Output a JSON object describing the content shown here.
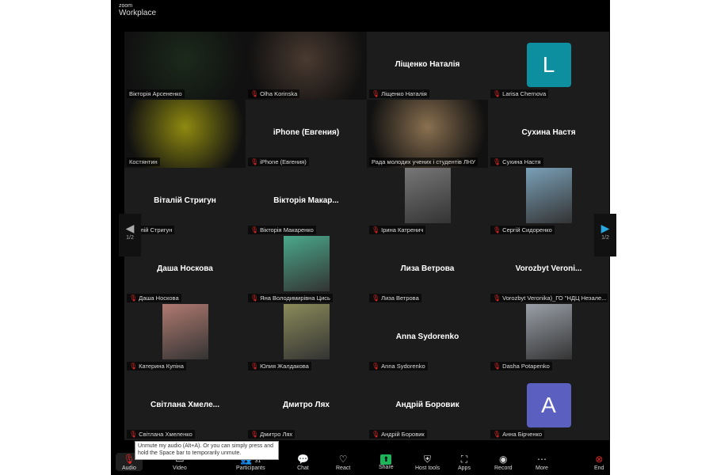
{
  "app": {
    "brand_small": "zoom",
    "brand": "Workplace"
  },
  "pager": {
    "left": "1/2",
    "right": "1/2"
  },
  "tiles": [
    {
      "name": "Вікторія Арсененко",
      "type": "video",
      "color": "#1b2a1b",
      "active": true,
      "muted": false
    },
    {
      "name": "Olha Korinska",
      "type": "video",
      "color": "#4a3a30",
      "muted": true
    },
    {
      "name": "Ліщенко Наталія",
      "center": "Ліщенко Наталія",
      "type": "name",
      "muted": true
    },
    {
      "name": "Larisa Chernova",
      "type": "avatar",
      "letter": "L",
      "color": "#0e8fa0",
      "muted": true
    },
    {
      "name": "Костянтин",
      "type": "video",
      "color": "#8f8a10",
      "muted": false
    },
    {
      "name": "iPhone (Евгения)",
      "center": "iPhone (Евгения)",
      "type": "name",
      "muted": true
    },
    {
      "name": "Рада молодих учених і студентів ЛНУ",
      "type": "video",
      "color": "#8a7050",
      "muted": false
    },
    {
      "name": "Сухина Настя",
      "center": "Сухина Настя",
      "type": "name",
      "muted": true
    },
    {
      "name": "Віталій Стригун",
      "center": "Віталій Стригун",
      "type": "name",
      "muted": false
    },
    {
      "name": "Вікторія Макаренко",
      "center": "Вікторія Макар...",
      "type": "name",
      "muted": true
    },
    {
      "name": "Ірина Катренич",
      "type": "photo",
      "color": "#777",
      "muted": true
    },
    {
      "name": "Сергій Сидоренко",
      "type": "photo",
      "color": "#7aa0b8",
      "muted": true
    },
    {
      "name": "Даша Носкова",
      "center": "Даша Носкова",
      "type": "name",
      "muted": true
    },
    {
      "name": "Яна Володимирівна Цись",
      "type": "photo",
      "color": "#4aa88a",
      "muted": true
    },
    {
      "name": "Лиза Ветрова",
      "center": "Лиза Ветрова",
      "type": "name",
      "muted": true
    },
    {
      "name": "Vorozbyt Veronika)_ГО \"НДЦ Незале...",
      "center": "Vorozbyt Veroni...",
      "type": "name",
      "muted": true
    },
    {
      "name": "Катерина Купіна",
      "type": "photo",
      "color": "#b07a70",
      "muted": true
    },
    {
      "name": "Юлия Жалдакова",
      "type": "photo",
      "color": "#8a8a5a",
      "muted": true
    },
    {
      "name": "Anna Sydorenko",
      "center": "Anna Sydorenko",
      "type": "name",
      "muted": true
    },
    {
      "name": "Dasha Potapenko",
      "type": "photo",
      "color": "#9aa0a8",
      "muted": true
    },
    {
      "name": "Світлана Хмеленко",
      "center": "Світлана Хмеле...",
      "type": "name",
      "muted": true
    },
    {
      "name": "Дмитро Лях",
      "center": "Дмитро Лях",
      "type": "name",
      "muted": true
    },
    {
      "name": "Андрій Боровик",
      "center": "Андрій Боровик",
      "type": "name",
      "muted": true
    },
    {
      "name": "Анна Бірченко",
      "type": "avatar",
      "letter": "A",
      "color": "#5a5fc0",
      "muted": true
    }
  ],
  "tooltip": "Unmute my audio (Alt+A). Or you can simply press and hold the Space bar to temporarily unmute.",
  "toolbar": {
    "audio": "Audio",
    "video": "Video",
    "participants": "Participants",
    "participants_count": "31",
    "chat": "Chat",
    "react": "React",
    "share": "Share",
    "host_tools": "Host tools",
    "apps": "Apps",
    "record": "Record",
    "more": "More",
    "end": "End"
  }
}
